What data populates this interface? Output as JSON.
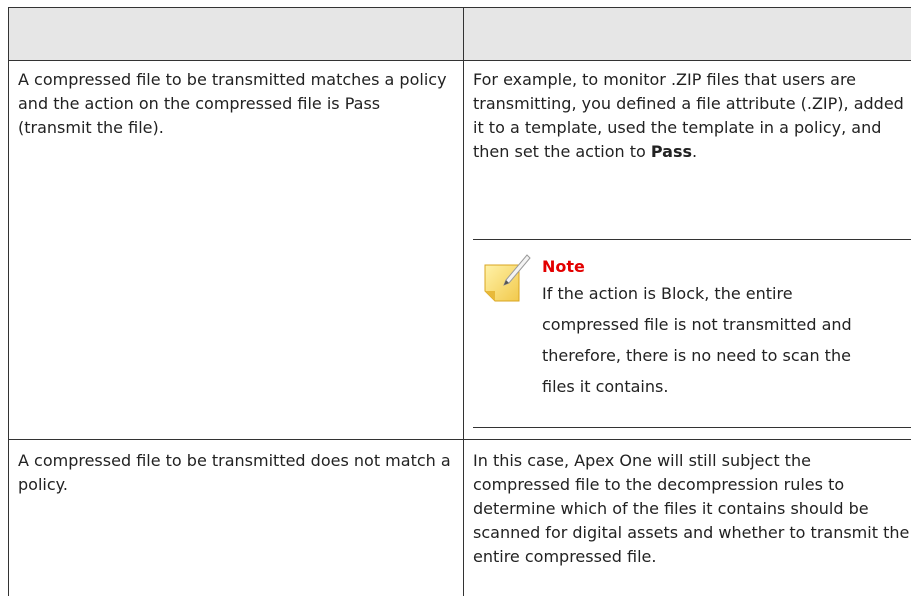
{
  "table": {
    "header": [
      "",
      ""
    ],
    "rows": [
      {
        "condition": "A compressed file to be transmitted matches a policy and the action on the compressed file is Pass (transmit the file).",
        "description_before": "For example, to monitor .ZIP files that users are transmitting, you defined a file attribute (.ZIP), added it to a template, used the template in a policy, and then set the action to ",
        "description_bold": "Pass",
        "description_after": ".",
        "note": {
          "title": "Note",
          "body": "If the action is Block, the entire compressed file is not transmitted and therefore, there is no need to scan the files it contains.",
          "icon": "note-pencil-icon"
        }
      },
      {
        "condition": "A compressed file to be transmitted does not match a policy.",
        "description": "In this case, Apex One will still subject the compressed file to the decompression rules to determine which of the files it contains should be scanned for digital assets and whether to transmit the entire compressed file."
      }
    ]
  },
  "colors": {
    "header_bg": "#e6e6e6",
    "note_title": "#e30000",
    "border": "#333333"
  }
}
